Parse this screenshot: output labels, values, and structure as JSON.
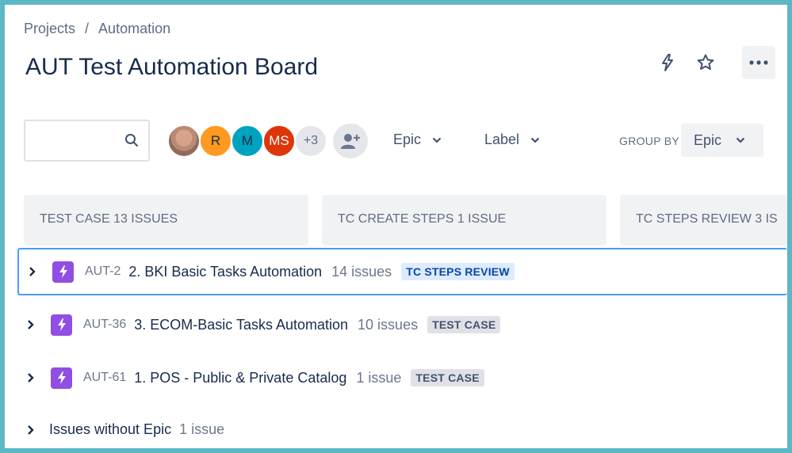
{
  "breadcrumb": {
    "root": "Projects",
    "separator": "/",
    "current": "Automation"
  },
  "page_title": "AUT Test Automation Board",
  "header_actions": {
    "automation_icon": "lightning-icon",
    "star_icon": "star-icon",
    "more_label": "•••"
  },
  "search": {
    "placeholder": "",
    "value": "",
    "icon": "search-icon"
  },
  "avatars": [
    {
      "type": "photo",
      "initials": ""
    },
    {
      "initials": "R",
      "color": "#ff991f"
    },
    {
      "initials": "M",
      "color": "#00a3bf"
    },
    {
      "initials": "MS",
      "color": "#de350b"
    }
  ],
  "avatars_more": "+3",
  "filters": {
    "epic_label": "Epic",
    "label_label": "Label"
  },
  "group_by": {
    "label": "GROUP BY",
    "value": "Epic"
  },
  "columns": [
    {
      "name": "TEST CASE 13 ISSUES"
    },
    {
      "name": "TC CREATE STEPS 1 ISSUE"
    },
    {
      "name": "TC STEPS REVIEW 3 IS"
    }
  ],
  "swimlanes": [
    {
      "key": "AUT-2",
      "title": "2. BKI Basic Tasks Automation",
      "count": "14 issues",
      "status": "TC STEPS REVIEW"
    },
    {
      "key": "AUT-36",
      "title": "3. ECOM-Basic Tasks Automation",
      "count": "10 issues",
      "status": "TEST CASE"
    },
    {
      "key": "AUT-61",
      "title": "1. POS - Public & Private Catalog",
      "count": "1 issue",
      "status": "TEST CASE"
    }
  ],
  "no_epic": {
    "label": "Issues without Epic",
    "count": "1 issue"
  },
  "colors": {
    "epic_purple": "#904ee2",
    "selected_border": "#4c9aff",
    "frame": "#5bb8c4"
  }
}
